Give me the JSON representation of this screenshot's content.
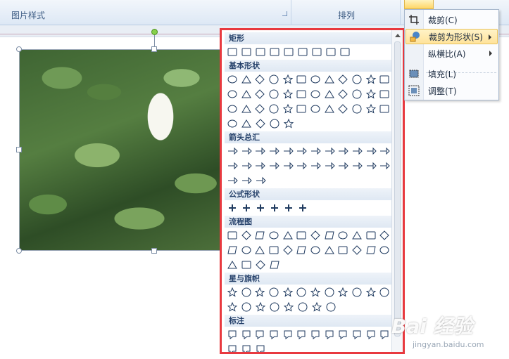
{
  "ribbon": {
    "group1_label": "图片样式",
    "group2_label": "排列"
  },
  "menu": {
    "items": [
      {
        "label": "裁剪(C)",
        "icon": "crop-icon"
      },
      {
        "label": "裁剪为形状(S)",
        "icon": "crop-to-shape-icon",
        "highlighted": true,
        "submenu": true
      },
      {
        "label": "纵横比(A)",
        "icon": "",
        "submenu": true
      },
      {
        "label": "填充(L)",
        "icon": "fill-icon"
      },
      {
        "label": "调整(T)",
        "icon": "fit-icon"
      }
    ]
  },
  "gallery": {
    "categories": [
      {
        "name": "矩形",
        "rows": [
          9
        ]
      },
      {
        "name": "基本形状",
        "rows": [
          12,
          12,
          12,
          5
        ]
      },
      {
        "name": "箭头总汇",
        "rows": [
          12,
          12,
          3
        ]
      },
      {
        "name": "公式形状",
        "rows": [
          6
        ]
      },
      {
        "name": "流程图",
        "rows": [
          12,
          12,
          4
        ]
      },
      {
        "name": "星与旗帜",
        "rows": [
          12,
          8
        ]
      },
      {
        "name": "标注",
        "rows": [
          12,
          3
        ]
      }
    ]
  },
  "watermark": {
    "logo": "Bai 经验",
    "url": "jingyan.baidu.com"
  },
  "colors": {
    "gallery_border": "#e8393f",
    "menu_highlight": "#ffe39a",
    "ribbon_bg": "#dde8f5"
  }
}
